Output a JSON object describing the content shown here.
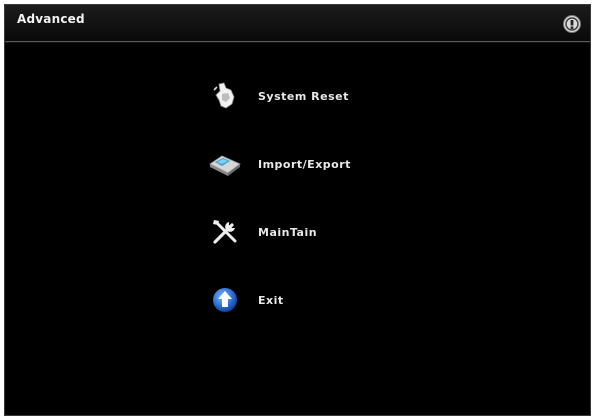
{
  "window": {
    "title": "Advanced",
    "help_icon": "help-icon"
  },
  "menu": {
    "items": [
      {
        "label": "System  Reset",
        "icon": "reset-hand-icon"
      },
      {
        "label": "Import/Export",
        "icon": "import-export-icon"
      },
      {
        "label": "MainTain",
        "icon": "tools-icon"
      },
      {
        "label": "Exit",
        "icon": "exit-arrow-icon"
      }
    ]
  },
  "colors": {
    "background": "#000000",
    "text": "#e8e8e8",
    "exit_icon": "#2a6fd6"
  }
}
